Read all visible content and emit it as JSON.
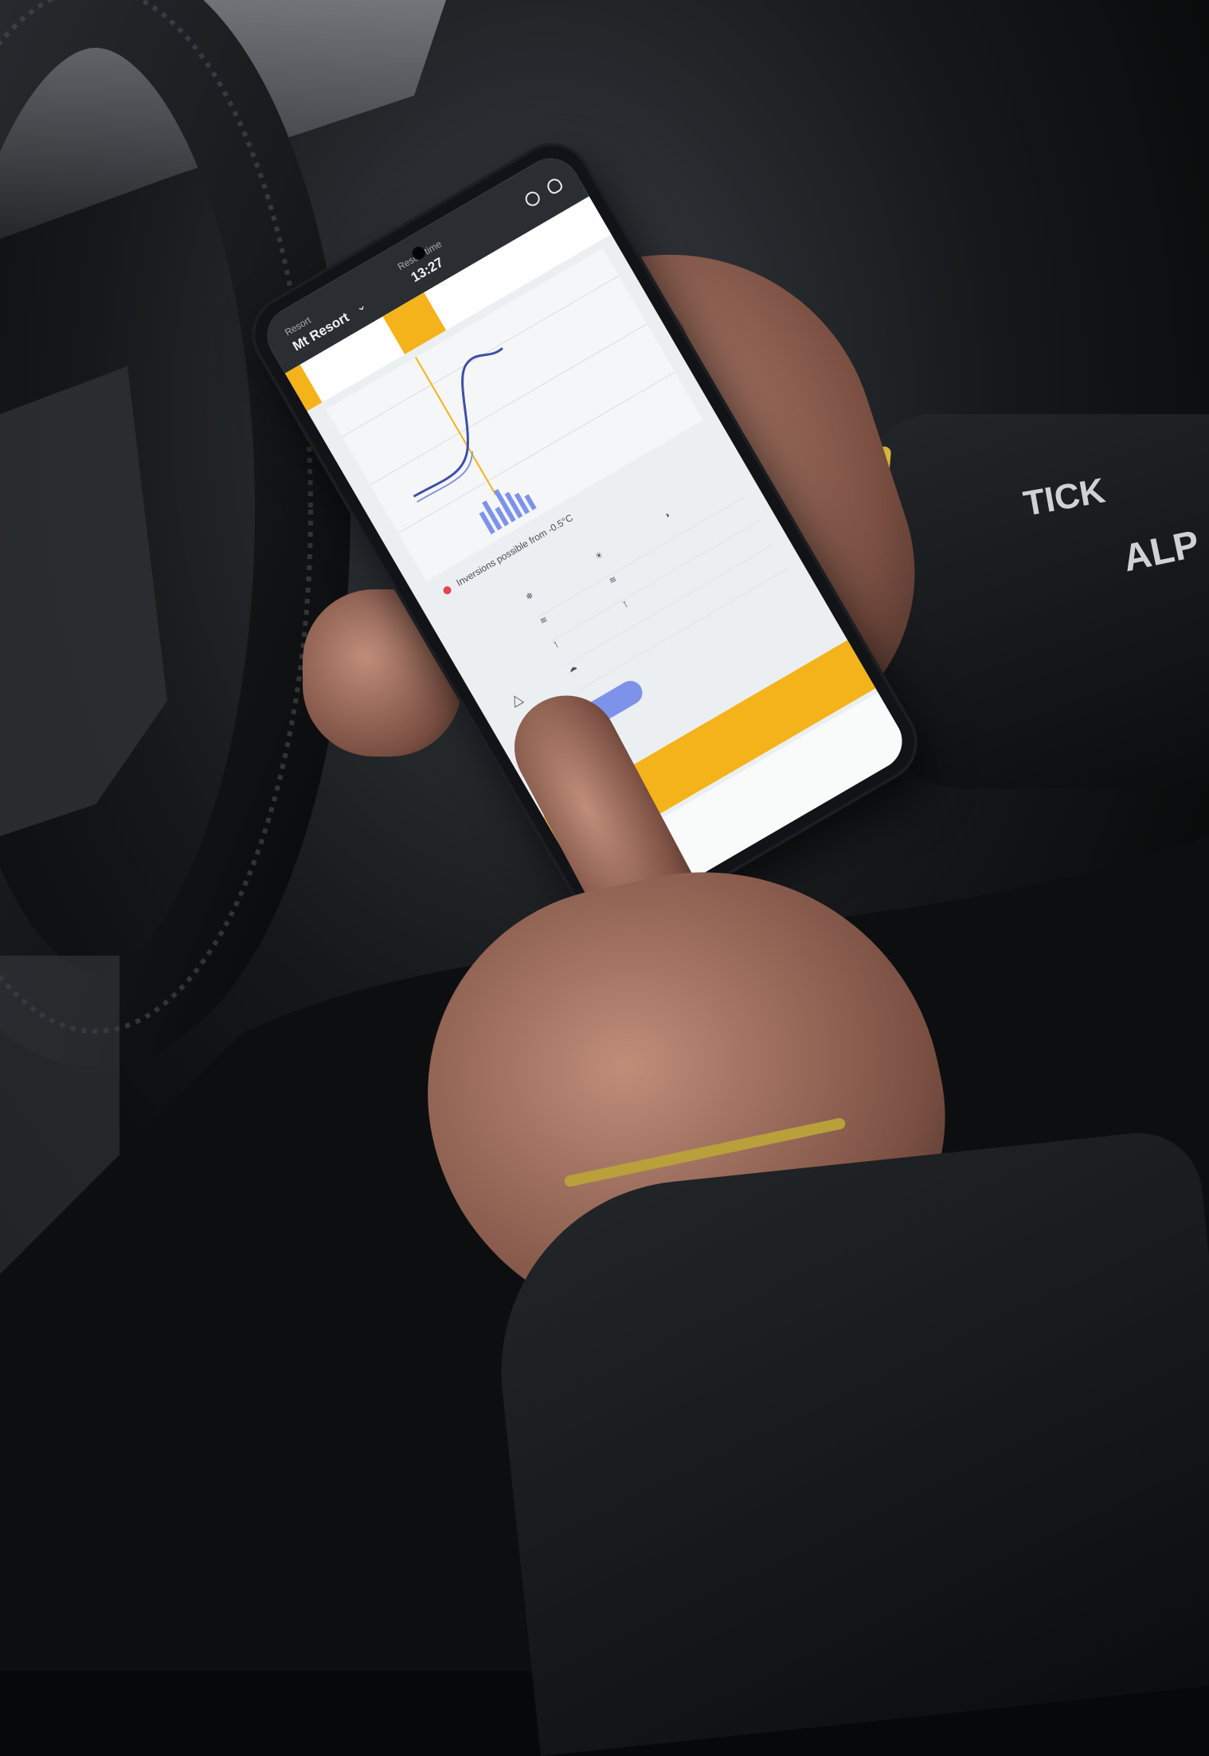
{
  "photo": {
    "subject": "hands-holding-phone",
    "colors": {
      "accent": "#f4b31a",
      "background": "#070809",
      "skin": "#b07f6c",
      "sleeve_accent": "#d8b43a"
    }
  },
  "app": {
    "header": {
      "resort_label": "Resort",
      "resort_name": "Mt Resort",
      "time_label": "Resort time",
      "time_value": "13:27"
    },
    "warning_text": "Inversions possible from -0.5°C"
  },
  "jacket": {
    "brand_text": "TICK",
    "logo_text": "ALP"
  }
}
